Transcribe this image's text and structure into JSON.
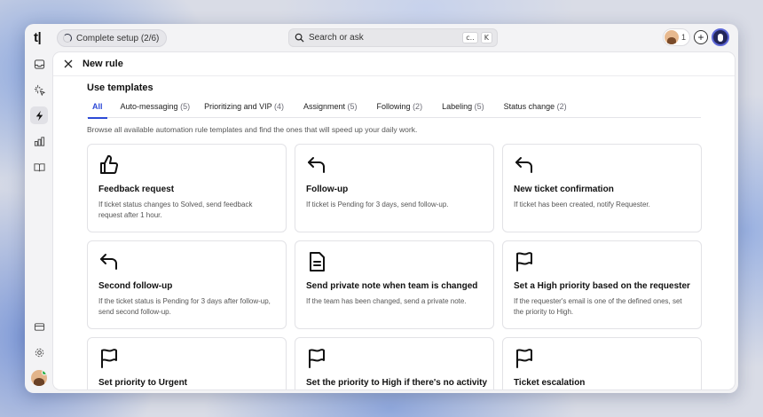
{
  "app": {
    "logo": "t|",
    "setup_label": "Complete setup (2/6)",
    "search_placeholder": "Search or ask",
    "search_shortcut": [
      "c..",
      "K"
    ],
    "agent_count": "1",
    "add_label": "+"
  },
  "sidebar": {
    "items": [
      {
        "icon": "inbox-icon"
      },
      {
        "icon": "sparkle-icon"
      },
      {
        "icon": "lightning-icon",
        "active": true
      },
      {
        "icon": "bar-chart-icon"
      },
      {
        "icon": "book-icon"
      },
      {
        "icon": "card-icon"
      },
      {
        "icon": "gear-icon"
      }
    ]
  },
  "panel": {
    "title": "New rule",
    "section_title": "Use templates",
    "description": "Browse all available automation rule templates and find the ones that will speed up your daily work.",
    "tabs": [
      {
        "label": "All",
        "count": ""
      },
      {
        "label": "Auto-messaging",
        "count": "(5)"
      },
      {
        "label": "Prioritizing and VIP",
        "count": "(4)"
      },
      {
        "label": "Assignment",
        "count": "(5)"
      },
      {
        "label": "Following",
        "count": "(2)"
      },
      {
        "label": "Labeling",
        "count": "(5)"
      },
      {
        "label": "Status change",
        "count": "(2)"
      }
    ],
    "cards": [
      {
        "icon": "thumbs-up-icon",
        "title": "Feedback request",
        "text": "If ticket status changes to Solved, send feedback request after 1 hour."
      },
      {
        "icon": "reply-arrow-icon",
        "title": "Follow-up",
        "text": "If ticket is Pending for 3 days, send follow-up."
      },
      {
        "icon": "reply-arrow-icon",
        "title": "New ticket confirmation",
        "text": "If ticket has been created, notify Requester."
      },
      {
        "icon": "reply-arrow-icon",
        "title": "Second follow-up",
        "text": "If the ticket status is Pending for 3 days after follow-up, send second follow-up."
      },
      {
        "icon": "document-icon",
        "title": "Send private note when team is changed",
        "text": "If the team has been changed, send a private note."
      },
      {
        "icon": "flag-icon",
        "title": "Set a High priority based on the requester",
        "text": "If the requester's email is one of the defined ones, set the priority to High."
      },
      {
        "icon": "flag-icon",
        "title": "Set priority to Urgent",
        "text": ""
      },
      {
        "icon": "flag-icon",
        "title": "Set the priority to High if there's no activity",
        "text": ""
      },
      {
        "icon": "flag-icon",
        "title": "Ticket escalation",
        "text": ""
      }
    ]
  }
}
